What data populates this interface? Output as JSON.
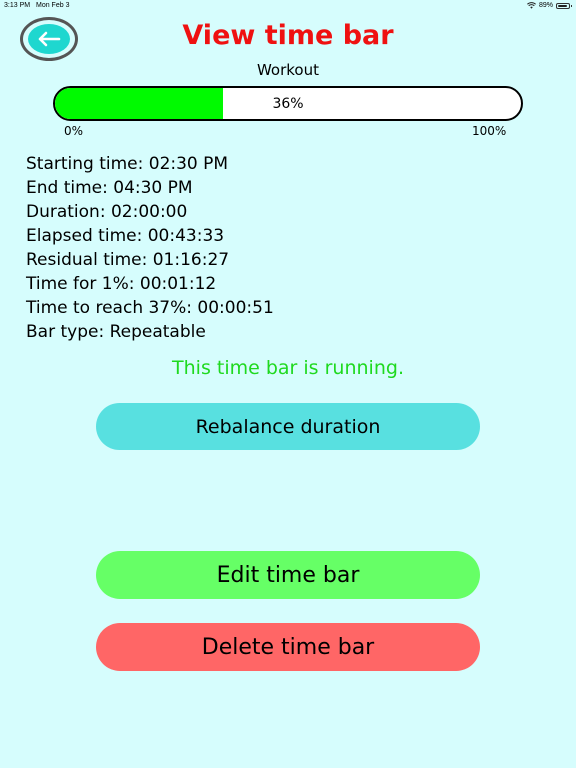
{
  "status_bar": {
    "time": "3:13 PM",
    "date": "Mon Feb 3",
    "battery": "89%",
    "battery_level": 0.89
  },
  "header": {
    "title": "View time bar",
    "bar_name": "Workout",
    "back_icon": "arrow-left-icon"
  },
  "progress": {
    "value": 0.36,
    "label": "36%",
    "min_label": "0%",
    "max_label": "100%",
    "fill_color": "#00fa00"
  },
  "details": [
    "Starting time: 02:30 PM",
    "End time: 04:30 PM",
    "Duration: 02:00:00",
    "Elapsed time: 00:43:33",
    "Residual time: 01:16:27",
    "Time for 1%: 00:01:12",
    "Time to reach 37%: 00:00:51",
    "Bar type: Repeatable"
  ],
  "status_message": "This time bar is running.",
  "actions": {
    "rebalance_label": "Rebalance duration",
    "edit_label": "Edit time bar",
    "delete_label": "Delete time bar"
  },
  "colors": {
    "background": "#d6fdfd",
    "title": "#ef1111",
    "running": "#1fd91f",
    "rebalance": "#58e0e0",
    "edit": "#66ff66",
    "delete": "#ff6666",
    "back": "#1ed7cf"
  }
}
